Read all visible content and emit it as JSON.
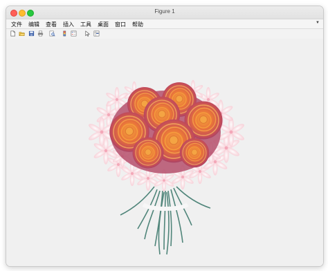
{
  "window": {
    "title": "Figure 1"
  },
  "menubar": {
    "items": [
      "文件",
      "编辑",
      "查看",
      "插入",
      "工具",
      "桌面",
      "窗口",
      "帮助"
    ],
    "overflow_icon": "chevron-down-icon"
  },
  "toolbar": {
    "icons": [
      "new-figure-icon",
      "open-file-icon",
      "save-icon",
      "print-icon",
      "print-preview-icon",
      "colorbar-icon",
      "legend-icon",
      "pointer-icon",
      "property-inspector-icon"
    ]
  },
  "figure": {
    "content": "rose-bouquet",
    "colors": {
      "rose_outer": "#b24a6e",
      "rose_inner": "#f29a36",
      "lily_petal": "#f9cfd6",
      "stem": "#3f7a6e"
    }
  }
}
